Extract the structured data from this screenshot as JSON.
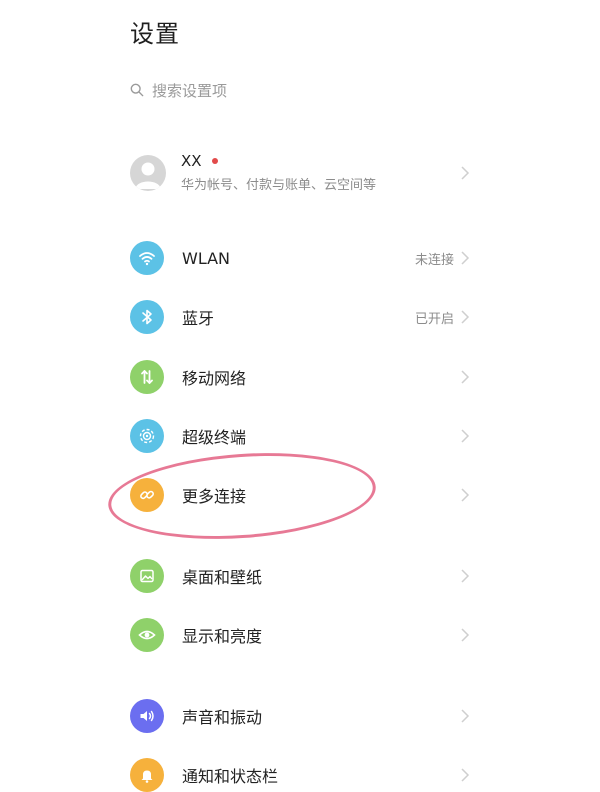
{
  "page": {
    "title": "设置"
  },
  "search": {
    "placeholder": "搜索设置项"
  },
  "account": {
    "name": "XX",
    "subtitle": "华为帐号、付款与账单、云空间等"
  },
  "items": [
    {
      "label": "WLAN",
      "value": "未连接",
      "icon": "wifi-icon",
      "color": "#5cc2e6"
    },
    {
      "label": "蓝牙",
      "value": "已开启",
      "icon": "bluetooth-icon",
      "color": "#5cc2e6"
    },
    {
      "label": "移动网络",
      "value": "",
      "icon": "mobile-data-icon",
      "color": "#8fd16a"
    },
    {
      "label": "超级终端",
      "value": "",
      "icon": "super-device-icon",
      "color": "#5cc2e6"
    },
    {
      "label": "更多连接",
      "value": "",
      "icon": "link-icon",
      "color": "#f6b13c"
    },
    {
      "label": "桌面和壁纸",
      "value": "",
      "icon": "wallpaper-icon",
      "color": "#8fd16a"
    },
    {
      "label": "显示和亮度",
      "value": "",
      "icon": "eye-icon",
      "color": "#8fd16a"
    },
    {
      "label": "声音和振动",
      "value": "",
      "icon": "sound-icon",
      "color": "#6b6ef0"
    },
    {
      "label": "通知和状态栏",
      "value": "",
      "icon": "bell-icon",
      "color": "#f6b13c"
    }
  ]
}
